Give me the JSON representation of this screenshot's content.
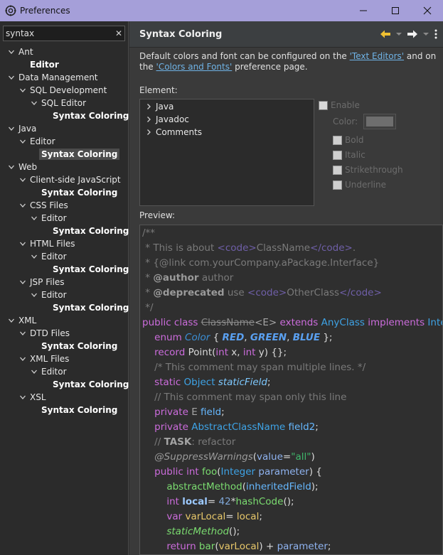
{
  "window": {
    "title": "Preferences",
    "controls": [
      "minimize",
      "maximize",
      "close"
    ]
  },
  "filter": {
    "value": "syntax"
  },
  "tree": [
    {
      "label": "Ant",
      "depth": 0,
      "twisty": "open",
      "bold": false
    },
    {
      "label": "Editor",
      "depth": 1,
      "twisty": "none",
      "bold": true
    },
    {
      "label": "Data Management",
      "depth": 0,
      "twisty": "open",
      "bold": false
    },
    {
      "label": "SQL Development",
      "depth": 1,
      "twisty": "open",
      "bold": false
    },
    {
      "label": "SQL Editor",
      "depth": 2,
      "twisty": "open",
      "bold": false
    },
    {
      "label": "Syntax Coloring",
      "depth": 3,
      "twisty": "none",
      "bold": true
    },
    {
      "label": "Java",
      "depth": 0,
      "twisty": "open",
      "bold": false
    },
    {
      "label": "Editor",
      "depth": 1,
      "twisty": "open",
      "bold": false
    },
    {
      "label": "Syntax Coloring",
      "depth": 2,
      "twisty": "none",
      "bold": true,
      "selected": true
    },
    {
      "label": "Web",
      "depth": 0,
      "twisty": "open",
      "bold": false
    },
    {
      "label": "Client-side JavaScript",
      "depth": 1,
      "twisty": "open",
      "bold": false
    },
    {
      "label": "Syntax Coloring",
      "depth": 2,
      "twisty": "none",
      "bold": true
    },
    {
      "label": "CSS Files",
      "depth": 1,
      "twisty": "open",
      "bold": false
    },
    {
      "label": "Editor",
      "depth": 2,
      "twisty": "open",
      "bold": false
    },
    {
      "label": "Syntax Coloring",
      "depth": 3,
      "twisty": "none",
      "bold": true
    },
    {
      "label": "HTML Files",
      "depth": 1,
      "twisty": "open",
      "bold": false
    },
    {
      "label": "Editor",
      "depth": 2,
      "twisty": "open",
      "bold": false
    },
    {
      "label": "Syntax Coloring",
      "depth": 3,
      "twisty": "none",
      "bold": true
    },
    {
      "label": "JSP Files",
      "depth": 1,
      "twisty": "open",
      "bold": false
    },
    {
      "label": "Editor",
      "depth": 2,
      "twisty": "open",
      "bold": false
    },
    {
      "label": "Syntax Coloring",
      "depth": 3,
      "twisty": "none",
      "bold": true
    },
    {
      "label": "XML",
      "depth": 0,
      "twisty": "open",
      "bold": false
    },
    {
      "label": "DTD Files",
      "depth": 1,
      "twisty": "open",
      "bold": false
    },
    {
      "label": "Syntax Coloring",
      "depth": 2,
      "twisty": "none",
      "bold": true
    },
    {
      "label": "XML Files",
      "depth": 1,
      "twisty": "open",
      "bold": false
    },
    {
      "label": "Editor",
      "depth": 2,
      "twisty": "open",
      "bold": false
    },
    {
      "label": "Syntax Coloring",
      "depth": 3,
      "twisty": "none",
      "bold": true
    },
    {
      "label": "XSL",
      "depth": 1,
      "twisty": "open",
      "bold": false
    },
    {
      "label": "Syntax Coloring",
      "depth": 2,
      "twisty": "none",
      "bold": true
    }
  ],
  "page": {
    "title": "Syntax Coloring",
    "description_pre": "Default colors and font can be configured on the ",
    "link1": "'Text Editors'",
    "description_mid": " and on the ",
    "link2": "'Colors and Fonts'",
    "description_post": " preference page.",
    "element_label": "Element:",
    "elements": [
      "Java",
      "Javadoc",
      "Comments"
    ],
    "options": {
      "enable": "Enable",
      "color": "Color:",
      "bold": "Bold",
      "italic": "Italic",
      "strikethrough": "Strikethrough",
      "underline": "Underline"
    },
    "preview_label": "Preview:"
  },
  "colors": {
    "titlebar": "#a59fd9",
    "accent_link": "#6fb3e6",
    "keyword": "#cc6cdc",
    "type": "#3ea3e6",
    "comment": "#7a7a7a",
    "string": "#3fb86b",
    "method": "#7bdc70"
  },
  "preview_code": [
    [
      [
        "c-comment",
        "/**"
      ]
    ],
    [
      [
        "c-comment",
        " * This is about "
      ],
      [
        "c-html",
        "<code>"
      ],
      [
        "c-comment",
        "ClassName"
      ],
      [
        "c-html",
        "</code>"
      ],
      [
        "c-comment",
        "."
      ]
    ],
    [
      [
        "c-comment",
        " * {@link com.yourCompany.aPackage.Interface}"
      ]
    ],
    [
      [
        "c-comment",
        " * "
      ],
      [
        "c-tag",
        "@author"
      ],
      [
        "c-comment",
        " author"
      ]
    ],
    [
      [
        "c-comment",
        " * "
      ],
      [
        "c-tag",
        "@deprecated"
      ],
      [
        "c-comment",
        " use "
      ],
      [
        "c-html",
        "<code>"
      ],
      [
        "c-comment",
        "OtherClass"
      ],
      [
        "c-html",
        "</code>"
      ]
    ],
    [
      [
        "c-comment",
        " */"
      ]
    ],
    [
      [
        "c-kw",
        "public class "
      ],
      [
        "c-strike",
        "ClassName"
      ],
      [
        "c-typevar",
        "<E>"
      ],
      [
        "c-kw",
        " extends "
      ],
      [
        "c-type",
        "AnyClass"
      ],
      [
        "c-kw",
        " implements "
      ],
      [
        "c-type",
        "InterfaceName"
      ]
    ],
    [
      [
        "c-plain",
        "    "
      ],
      [
        "c-kw",
        "enum "
      ],
      [
        "c-enum",
        "Color"
      ],
      [
        "c-plain",
        " { "
      ],
      [
        "c-const",
        "RED"
      ],
      [
        "c-plain",
        ", "
      ],
      [
        "c-const",
        "GREEN"
      ],
      [
        "c-plain",
        ", "
      ],
      [
        "c-const",
        "BLUE"
      ],
      [
        "c-plain",
        " };"
      ]
    ],
    [
      [
        "c-plain",
        "    "
      ],
      [
        "c-kw",
        "record "
      ],
      [
        "c-plain",
        "Point("
      ],
      [
        "c-kw",
        "int "
      ],
      [
        "c-plain",
        "x, "
      ],
      [
        "c-kw",
        "int "
      ],
      [
        "c-plain",
        "y) {};"
      ]
    ],
    [
      [
        "c-comment",
        "    /* This comment may span multiple lines. */"
      ]
    ],
    [
      [
        "c-plain",
        "    "
      ],
      [
        "c-kw",
        "static "
      ],
      [
        "c-type",
        "Object "
      ],
      [
        "c-static",
        "staticField"
      ],
      [
        "c-plain",
        ";"
      ]
    ],
    [
      [
        "c-comment",
        "    // This comment may span only this line"
      ]
    ],
    [
      [
        "c-plain",
        "    "
      ],
      [
        "c-kw",
        "private "
      ],
      [
        "c-typevar",
        "E "
      ],
      [
        "c-field",
        "field"
      ],
      [
        "c-plain",
        ";"
      ]
    ],
    [
      [
        "c-plain",
        "    "
      ],
      [
        "c-kw",
        "private "
      ],
      [
        "c-type",
        "AbstractClassName "
      ],
      [
        "c-field",
        "field2"
      ],
      [
        "c-plain",
        ";"
      ]
    ],
    [
      [
        "c-comment",
        "    // "
      ],
      [
        "c-task",
        "TASK"
      ],
      [
        "c-comment",
        ": refactor"
      ]
    ],
    [
      [
        "c-plain",
        "    "
      ],
      [
        "c-ann",
        "@SuppressWarnings"
      ],
      [
        "c-plain",
        "("
      ],
      [
        "c-param",
        "value"
      ],
      [
        "c-plain",
        "="
      ],
      [
        "c-str",
        "\"all\""
      ],
      [
        "c-plain",
        ")"
      ]
    ],
    [
      [
        "c-plain",
        "    "
      ],
      [
        "c-kw",
        "public int "
      ],
      [
        "c-method",
        "foo"
      ],
      [
        "c-plain",
        "("
      ],
      [
        "c-type",
        "Integer "
      ],
      [
        "c-param",
        "parameter"
      ],
      [
        "c-plain",
        ") {"
      ]
    ],
    [
      [
        "c-plain",
        "        "
      ],
      [
        "c-method",
        "abstractMethod"
      ],
      [
        "c-plain",
        "("
      ],
      [
        "c-field",
        "inheritedField"
      ],
      [
        "c-plain",
        ");"
      ]
    ],
    [
      [
        "c-plain",
        "        "
      ],
      [
        "c-kw",
        "int "
      ],
      [
        "c-localb",
        "local"
      ],
      [
        "c-plain",
        "= "
      ],
      [
        "c-num",
        "42"
      ],
      [
        "c-plain",
        "*"
      ],
      [
        "c-method",
        "hashCode"
      ],
      [
        "c-plain",
        "();"
      ]
    ],
    [
      [
        "c-plain",
        "        "
      ],
      [
        "c-kw",
        "var "
      ],
      [
        "c-local",
        "varLocal"
      ],
      [
        "c-plain",
        "= "
      ],
      [
        "c-local",
        "local"
      ],
      [
        "c-plain",
        ";"
      ]
    ],
    [
      [
        "c-plain",
        "        "
      ],
      [
        "c-method-i",
        "staticMethod"
      ],
      [
        "c-plain",
        "();"
      ]
    ],
    [
      [
        "c-plain",
        "        "
      ],
      [
        "c-kw",
        "return "
      ],
      [
        "c-method",
        "bar"
      ],
      [
        "c-plain",
        "("
      ],
      [
        "c-local",
        "varLocal"
      ],
      [
        "c-plain",
        ") + "
      ],
      [
        "c-param",
        "parameter"
      ],
      [
        "c-plain",
        ";"
      ]
    ]
  ]
}
